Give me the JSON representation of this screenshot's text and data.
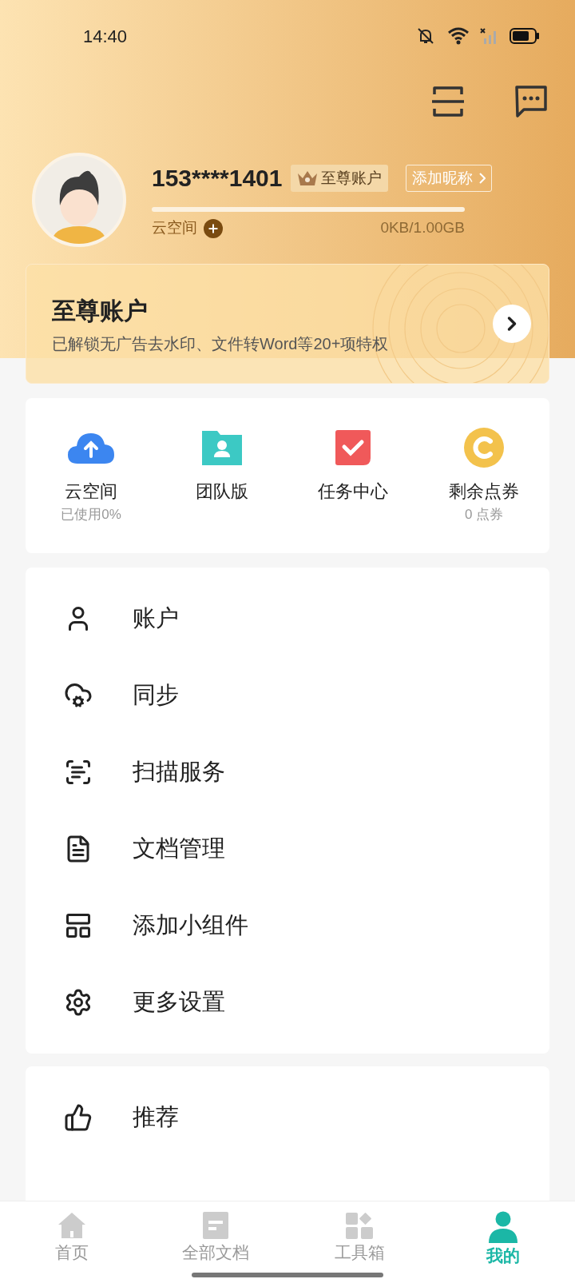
{
  "status_bar": {
    "time": "14:40"
  },
  "profile": {
    "phone": "153****1401",
    "badge": "至尊账户",
    "nickname_button": "添加昵称",
    "storage_label": "云空间",
    "storage": {
      "level": 0,
      "reading": "0KB/1.00GB"
    }
  },
  "vip_card": {
    "title": "至尊账户",
    "subtitle": "已解锁无广告去水印、文件转Word等20+项特权"
  },
  "shortcuts": [
    {
      "kind": "cloud",
      "label": "云空间",
      "sub": "已使用0%"
    },
    {
      "kind": "team",
      "label": "团队版"
    },
    {
      "kind": "task",
      "label": "任务中心"
    },
    {
      "kind": "coin",
      "label": "剩余点券",
      "sub": "0 点券"
    }
  ],
  "menu": [
    {
      "kind": "account",
      "label": "账户"
    },
    {
      "kind": "sync",
      "label": "同步"
    },
    {
      "kind": "scan",
      "label": "扫描服务"
    },
    {
      "kind": "docs",
      "label": "文档管理"
    },
    {
      "kind": "widget",
      "label": "添加小组件"
    },
    {
      "kind": "settings",
      "label": "更多设置"
    }
  ],
  "menu_2": [
    {
      "kind": "like",
      "label": "推荐"
    }
  ],
  "bottom_nav": [
    {
      "kind": "home",
      "label": "首页",
      "selected": false
    },
    {
      "kind": "doc",
      "label": "全部文档",
      "selected": false
    },
    {
      "kind": "tools",
      "label": "工具箱",
      "selected": false
    },
    {
      "kind": "me",
      "label": "我的",
      "selected": true
    }
  ]
}
